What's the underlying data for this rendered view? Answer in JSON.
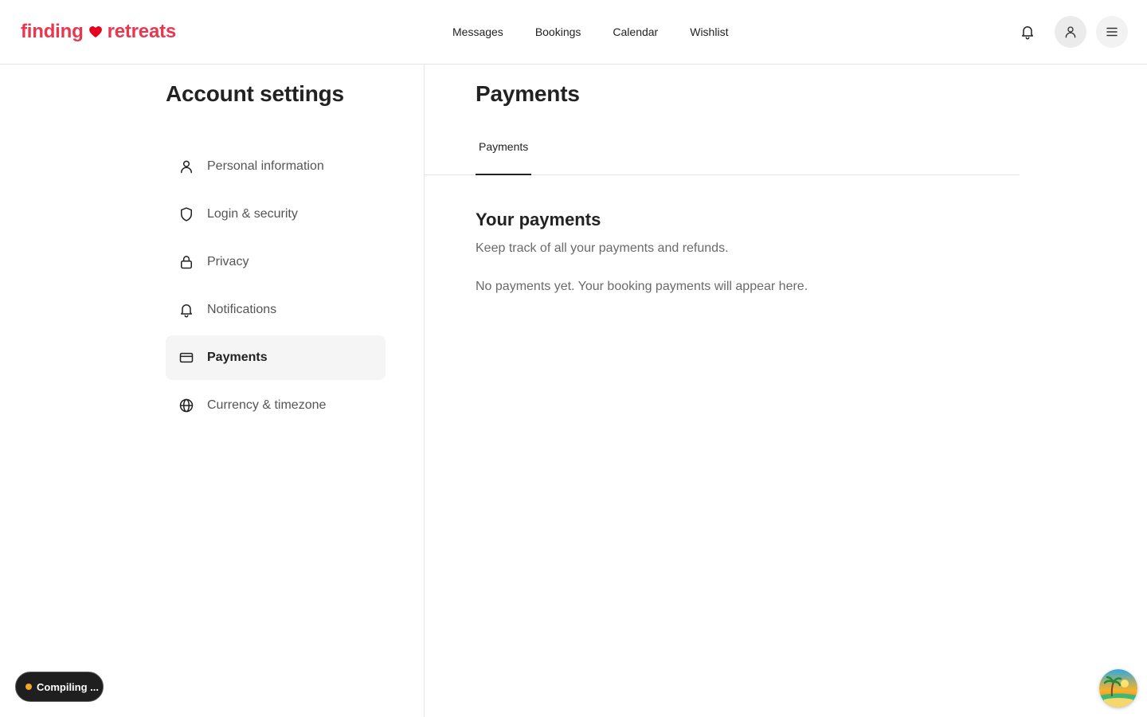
{
  "brand": {
    "left": "finding",
    "right": "retreats",
    "color": "#e8384f",
    "heart_icon": "heart-icon"
  },
  "nav": {
    "items": [
      {
        "label": "Messages"
      },
      {
        "label": "Bookings"
      },
      {
        "label": "Calendar"
      },
      {
        "label": "Wishlist"
      }
    ]
  },
  "header_actions": {
    "notifications_icon": "bell-icon",
    "profile_icon": "user-icon",
    "menu_icon": "hamburger-icon"
  },
  "sidebar": {
    "title": "Account settings",
    "items": [
      {
        "label": "Personal information",
        "icon": "user-icon",
        "active": false
      },
      {
        "label": "Login & security",
        "icon": "shield-icon",
        "active": false
      },
      {
        "label": "Privacy",
        "icon": "lock-icon",
        "active": false
      },
      {
        "label": "Notifications",
        "icon": "bell-icon",
        "active": false
      },
      {
        "label": "Payments",
        "icon": "credit-card-icon",
        "active": true
      },
      {
        "label": "Currency & timezone",
        "icon": "globe-icon",
        "active": false
      }
    ]
  },
  "main": {
    "title": "Payments",
    "tabs": [
      {
        "label": "Payments",
        "active": true
      }
    ],
    "section": {
      "title": "Your payments",
      "subtitle": "Keep track of all your payments and refunds.",
      "empty_message": "No payments yet. Your booking payments will appear here."
    }
  },
  "status": {
    "compile_label": "Compiling ...",
    "dot_color": "#f5a623"
  },
  "corner_badge_icon": "beach-island-icon"
}
